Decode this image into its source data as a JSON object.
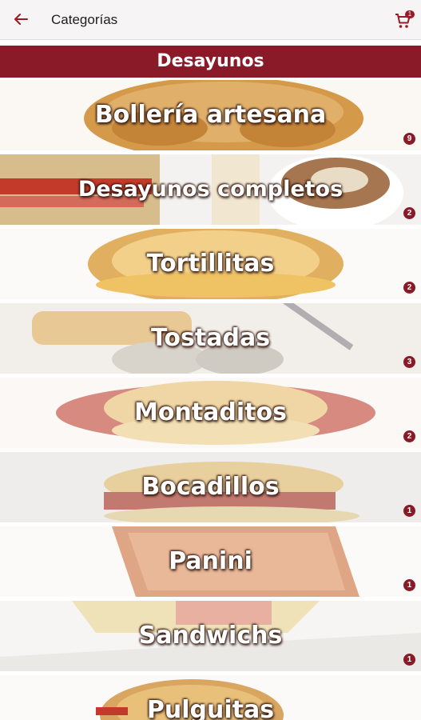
{
  "header": {
    "title": "Categorías",
    "cart_count": "1"
  },
  "section": {
    "title": "Desayunos"
  },
  "categories": [
    {
      "name": "Bollería artesana",
      "count": "9"
    },
    {
      "name": "Desayunos completos",
      "count": "2"
    },
    {
      "name": "Tortillitas",
      "count": "2"
    },
    {
      "name": "Tostadas",
      "count": "3"
    },
    {
      "name": "Montaditos",
      "count": "2"
    },
    {
      "name": "Bocadillos",
      "count": "1"
    },
    {
      "name": "Panini",
      "count": "1"
    },
    {
      "name": "Sandwichs",
      "count": "1"
    },
    {
      "name": "Pulguitas",
      "count": ""
    }
  ],
  "colors": {
    "brand": "#8a1a28",
    "appbar": "#f6f4f4"
  }
}
